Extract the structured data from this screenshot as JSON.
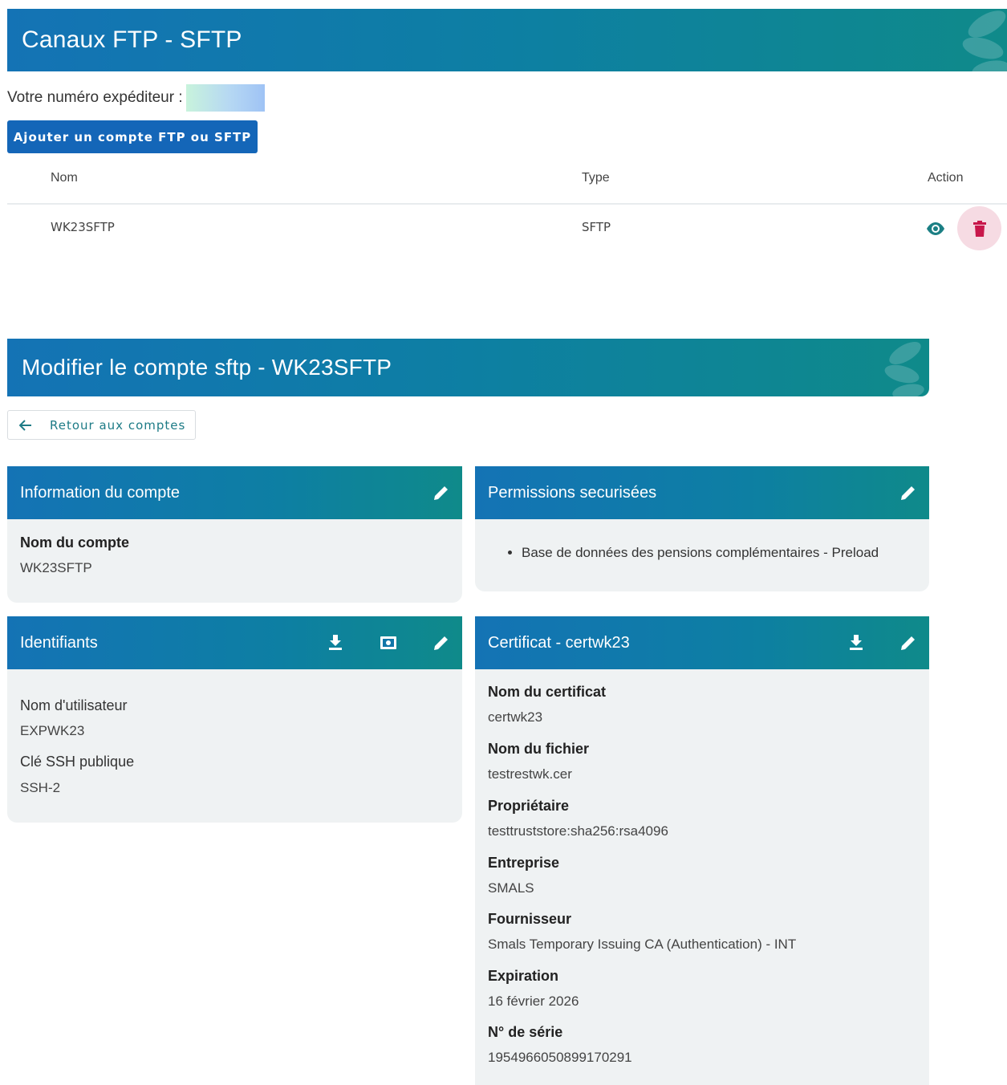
{
  "page": {
    "title": "Canaux FTP - SFTP",
    "sender_label": "Votre numéro expéditeur :",
    "add_button": "Ajouter un compte FTP ou SFTP"
  },
  "table": {
    "headers": {
      "name": "Nom",
      "type": "Type",
      "action": "Action"
    },
    "rows": [
      {
        "name": "WK23SFTP",
        "type": "SFTP"
      }
    ]
  },
  "edit": {
    "title": "Modifier le compte sftp - WK23SFTP",
    "back_label": "Retour aux comptes"
  },
  "info_card": {
    "title": "Information du compte",
    "account_name_label": "Nom du compte",
    "account_name": "WK23SFTP"
  },
  "perm_card": {
    "title": "Permissions securisées",
    "items": [
      "Base de données des pensions complémentaires - Preload"
    ]
  },
  "ident_card": {
    "title": "Identifiants",
    "username_label": "Nom d'utilisateur",
    "username": "EXPWK23",
    "ssh_label": "Clé SSH publique",
    "ssh_value": "SSH-2"
  },
  "cert_card": {
    "title": "Certificat - certwk23",
    "fields": [
      {
        "label": "Nom du certificat",
        "value": "certwk23"
      },
      {
        "label": "Nom du fichier",
        "value": "testrestwk.cer"
      },
      {
        "label": "Propriétaire",
        "value": "testtruststore:sha256:rsa4096"
      },
      {
        "label": "Entreprise",
        "value": "SMALS"
      },
      {
        "label": "Fournisseur",
        "value": "Smals Temporary Issuing CA (Authentication) - INT"
      },
      {
        "label": "Expiration",
        "value": "16 février 2026"
      },
      {
        "label": "N° de série",
        "value": "1954966050899170291"
      }
    ]
  },
  "colors": {
    "banner_start": "#1473b5",
    "banner_end": "#0f8a8a",
    "primary_button": "#1466b8",
    "delete_icon": "#c8174b",
    "delete_bg": "#f6dbe3",
    "eye_icon": "#1b7f84",
    "card_bg": "#eff2f3"
  },
  "icons": {
    "view": "eye-icon",
    "delete": "trash-icon",
    "back": "arrow-left-icon",
    "edit": "pencil-icon",
    "download": "download-icon",
    "screen": "monitor-icon"
  }
}
